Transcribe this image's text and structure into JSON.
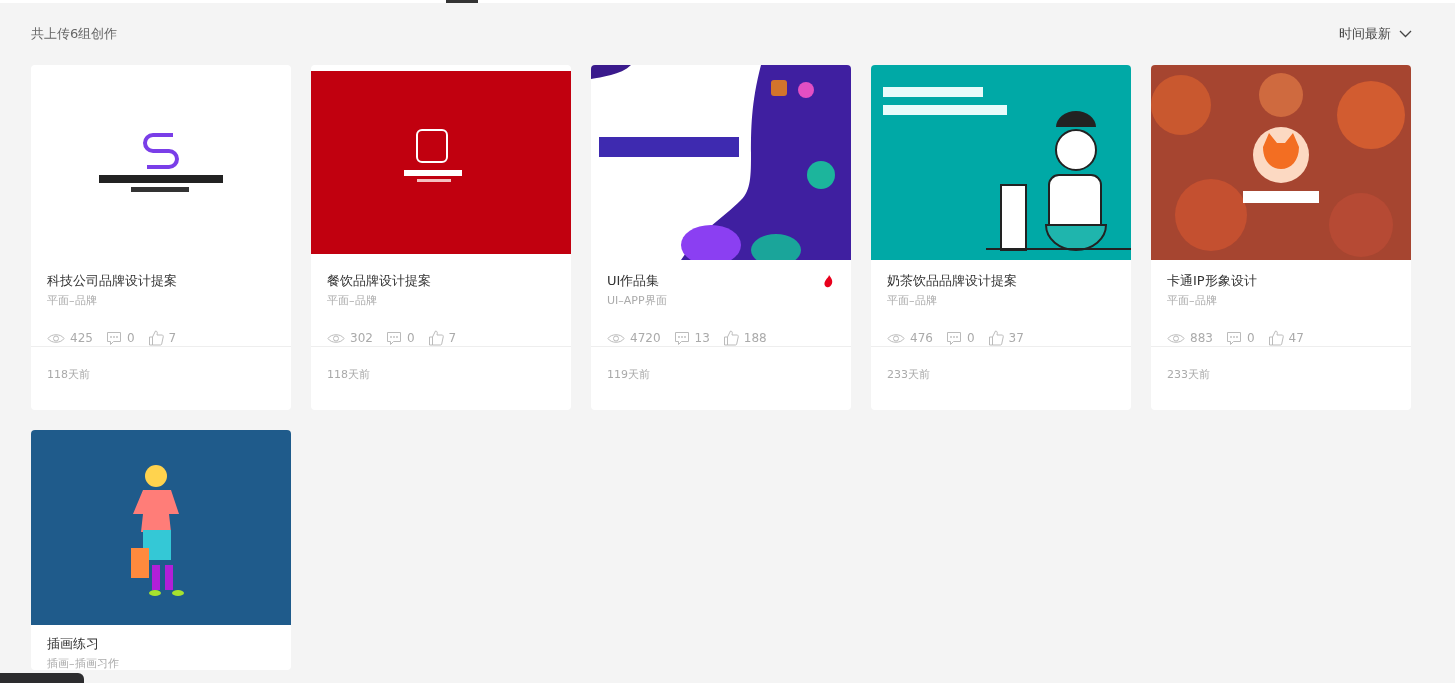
{
  "header": {
    "count_text": "共上传6组创作",
    "sort": "时间最新"
  },
  "works": [
    {
      "title": "科技公司品牌设计提案",
      "category": "平面–品牌",
      "views": "425",
      "comments": "0",
      "likes": "7",
      "age": "118天前",
      "hot": false
    },
    {
      "title": "餐饮品牌设计提案",
      "category": "平面–品牌",
      "views": "302",
      "comments": "0",
      "likes": "7",
      "age": "118天前",
      "hot": false
    },
    {
      "title": "UI作品集",
      "category": "UI–APP界面",
      "views": "4720",
      "comments": "13",
      "likes": "188",
      "age": "119天前",
      "hot": true
    },
    {
      "title": "奶茶饮品品牌设计提案",
      "category": "平面–品牌",
      "views": "476",
      "comments": "0",
      "likes": "37",
      "age": "233天前",
      "hot": false
    },
    {
      "title": "卡通IP形象设计",
      "category": "平面–品牌",
      "views": "883",
      "comments": "0",
      "likes": "47",
      "age": "233天前",
      "hot": false
    },
    {
      "title": "插画练习",
      "category": "插画–插画习作"
    }
  ]
}
